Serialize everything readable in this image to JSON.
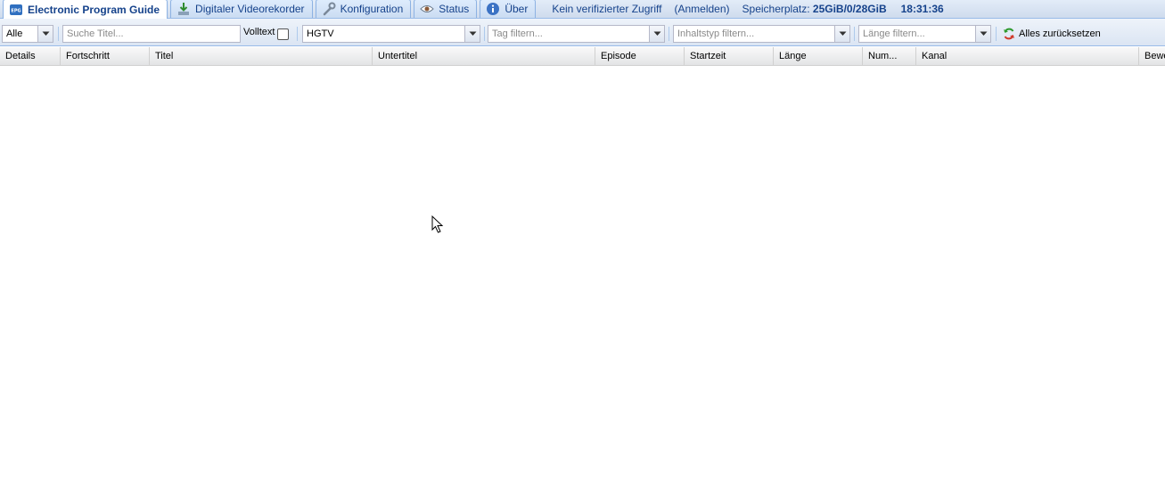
{
  "tabs": [
    {
      "label": "Electronic Program Guide",
      "icon": "epg-icon",
      "active": true
    },
    {
      "label": "Digitaler Videorekorder",
      "icon": "download-icon",
      "active": false
    },
    {
      "label": "Konfiguration",
      "icon": "wrench-icon",
      "active": false
    },
    {
      "label": "Status",
      "icon": "eye-icon",
      "active": false
    },
    {
      "label": "Über",
      "icon": "info-icon",
      "active": false
    }
  ],
  "status": {
    "access": "Kein verifizierter Zugriff",
    "login": "(Anmelden)",
    "storage_label": "Speicherplatz:",
    "storage_value": "25GiB/0/28GiB",
    "time": "18:31:36"
  },
  "filters": {
    "scope": {
      "value": "Alle"
    },
    "title_search": {
      "placeholder": "Suche Titel..."
    },
    "fulltext": {
      "label": "Volltext",
      "checked": false
    },
    "channel": {
      "value": "HGTV"
    },
    "tag": {
      "placeholder": "Tag filtern..."
    },
    "content_type": {
      "placeholder": "Inhaltstyp filtern..."
    },
    "duration": {
      "placeholder": "Länge filtern..."
    },
    "reset": {
      "label": "Alles zurücksetzen"
    }
  },
  "grid": {
    "columns": [
      "Details",
      "Fortschritt",
      "Titel",
      "Untertitel",
      "Episode",
      "Startzeit",
      "Länge",
      "Num...",
      "Kanal",
      "Bewertung"
    ],
    "rows": []
  },
  "colors": {
    "accent": "#15428b",
    "border": "#99bbe8"
  }
}
